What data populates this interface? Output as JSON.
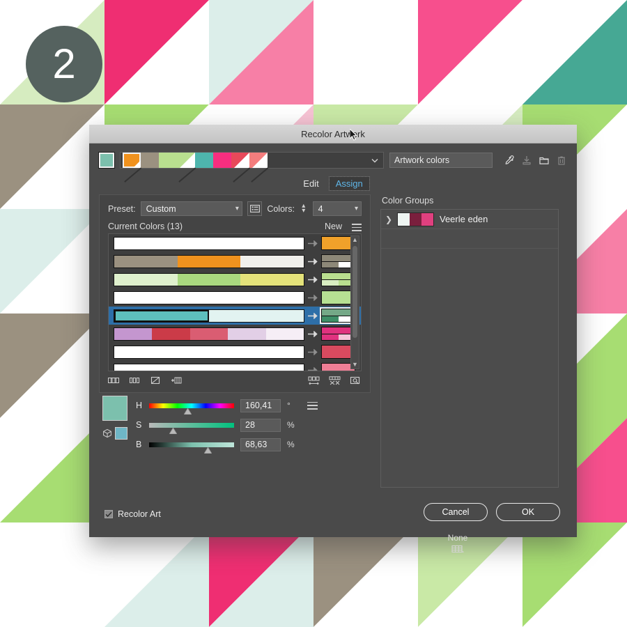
{
  "step_badge": {
    "number": "2"
  },
  "dialog": {
    "title": "Recolor Artwork",
    "name_field_value": "Artwork colors",
    "tabs": [
      {
        "label": "Edit",
        "active": false
      },
      {
        "label": "Assign",
        "active": true
      }
    ],
    "preset": {
      "label": "Preset:",
      "value": "Custom"
    },
    "colors": {
      "label": "Colors:",
      "value": "4"
    },
    "current_colors": {
      "label": "Current Colors (13)",
      "count": 13
    },
    "new_column_label": "New",
    "none_label": "None",
    "color_groups": {
      "label": "Color Groups",
      "items": [
        {
          "name": "Veerle eden",
          "swatches": [
            "#eef5f2",
            "#7a1f3d",
            "#e0407f"
          ]
        }
      ]
    },
    "sliders": [
      {
        "channel": "H",
        "value": "160,41",
        "unit": "°",
        "knob_pct": 45
      },
      {
        "channel": "S",
        "value": "28",
        "unit": "%",
        "knob_pct": 28
      },
      {
        "channel": "B",
        "value": "68,63",
        "unit": "%",
        "knob_pct": 69
      }
    ],
    "active_color": {
      "hex": "#7cc0ad"
    },
    "secondary_color": {
      "hex": "#6fb6c6"
    },
    "recolor_art": {
      "label": "Recolor Art",
      "checked": true
    },
    "cancel_label": "Cancel",
    "ok_label": "OK",
    "top_strip": [
      {
        "hex": "#f0921e",
        "style": "corner"
      },
      {
        "hex": "#9b9180",
        "style": "plain"
      },
      {
        "hex": "#b9df8f",
        "style": "plain"
      },
      {
        "hex": "#b9df8f",
        "style": "slash"
      },
      {
        "hex": "#4eb5ad",
        "style": "plain"
      },
      {
        "hex": "#f72e7f",
        "style": "plain"
      },
      {
        "hex": "#e8495a",
        "style": "slash"
      },
      {
        "hex": "#f47d7d",
        "style": "slash"
      }
    ],
    "color_rows": [
      {
        "selected": false,
        "current": [
          "#ffffff"
        ],
        "new": {
          "top": "#f0a12a",
          "bottom": []
        }
      },
      {
        "selected": false,
        "current": [
          "#9b9180",
          "#f0921e",
          "#f1f0ec"
        ],
        "new": {
          "top": "#8d8878",
          "bottom": [
            "#8d8878",
            "#ffffff"
          ]
        }
      },
      {
        "selected": false,
        "current": [
          "#dff0cd",
          "#a9d87f",
          "#e4e27a"
        ],
        "new": {
          "top": "#b9df8f",
          "bottom": [
            "#d9eec2",
            "#b9df8f"
          ]
        }
      },
      {
        "selected": false,
        "current": [
          "#ffffff"
        ],
        "new": {
          "top": "#b6e093",
          "bottom": []
        }
      },
      {
        "selected": true,
        "current": [
          "#5ec0bd",
          "#e2f3f1"
        ],
        "new": {
          "top": "#74a887",
          "bottom": [
            "#3f8f68",
            "#ffffff"
          ]
        }
      },
      {
        "selected": false,
        "current": [
          "#c496cf",
          "#cb3b48",
          "#da5d72",
          "#e2cfe6",
          "#f6eef6"
        ],
        "new": {
          "top": "#e0327f",
          "bottom": [
            "#e0327f",
            "#f6c4da"
          ]
        }
      },
      {
        "selected": false,
        "current": [
          "#ffffff"
        ],
        "new": {
          "top": "#d94a5f",
          "bottom": []
        }
      },
      {
        "selected": false,
        "current": [
          "#ffffff"
        ],
        "new": {
          "top": "#ee7e95",
          "bottom": []
        }
      }
    ],
    "icons": {
      "eyedropper": "eyedropper-icon",
      "save": "save-icon",
      "folder": "folder-icon",
      "trash": "trash-icon",
      "menu": "hamburger-menu-icon",
      "grid": "grid-icon"
    }
  }
}
